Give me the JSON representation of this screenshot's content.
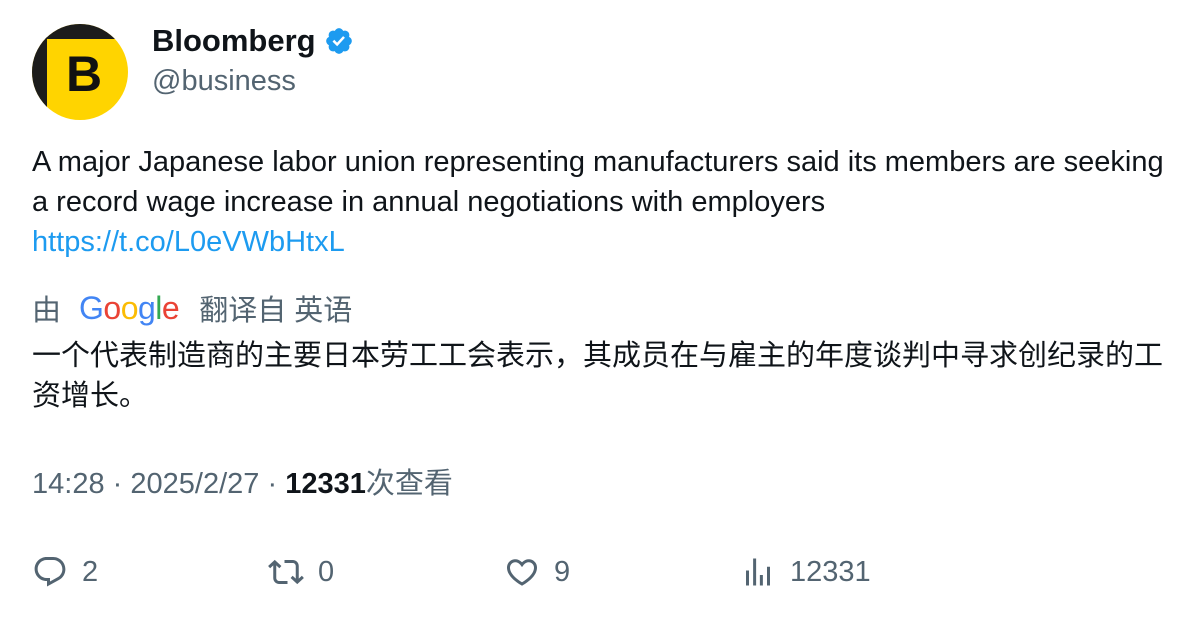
{
  "author": {
    "name": "Bloomberg",
    "handle": "@business",
    "avatar_letter": "B",
    "verified": true
  },
  "tweet": {
    "text": "A major Japanese labor union representing manufacturers said its members are seeking a record wage increase in annual negotiations with employers",
    "link": "https://t.co/L0eVWbHtxL"
  },
  "translation": {
    "prefix": "由",
    "provider": "Google",
    "suffix": "翻译自 英语",
    "text": "一个代表制造商的主要日本劳工工会表示，其成员在与雇主的年度谈判中寻求创纪录的工资增长。"
  },
  "meta": {
    "time": "14:28",
    "separator": "·",
    "date": "2025/2/27",
    "views_count": "12331",
    "views_label": "次查看"
  },
  "actions": {
    "replies": "2",
    "retweets": "0",
    "likes": "9",
    "views": "12331"
  },
  "colors": {
    "text": "#0f1419",
    "secondary": "#536471",
    "link": "#1d9bf0",
    "verified": "#1d9bf0",
    "avatar_bg": "#ffd400"
  }
}
